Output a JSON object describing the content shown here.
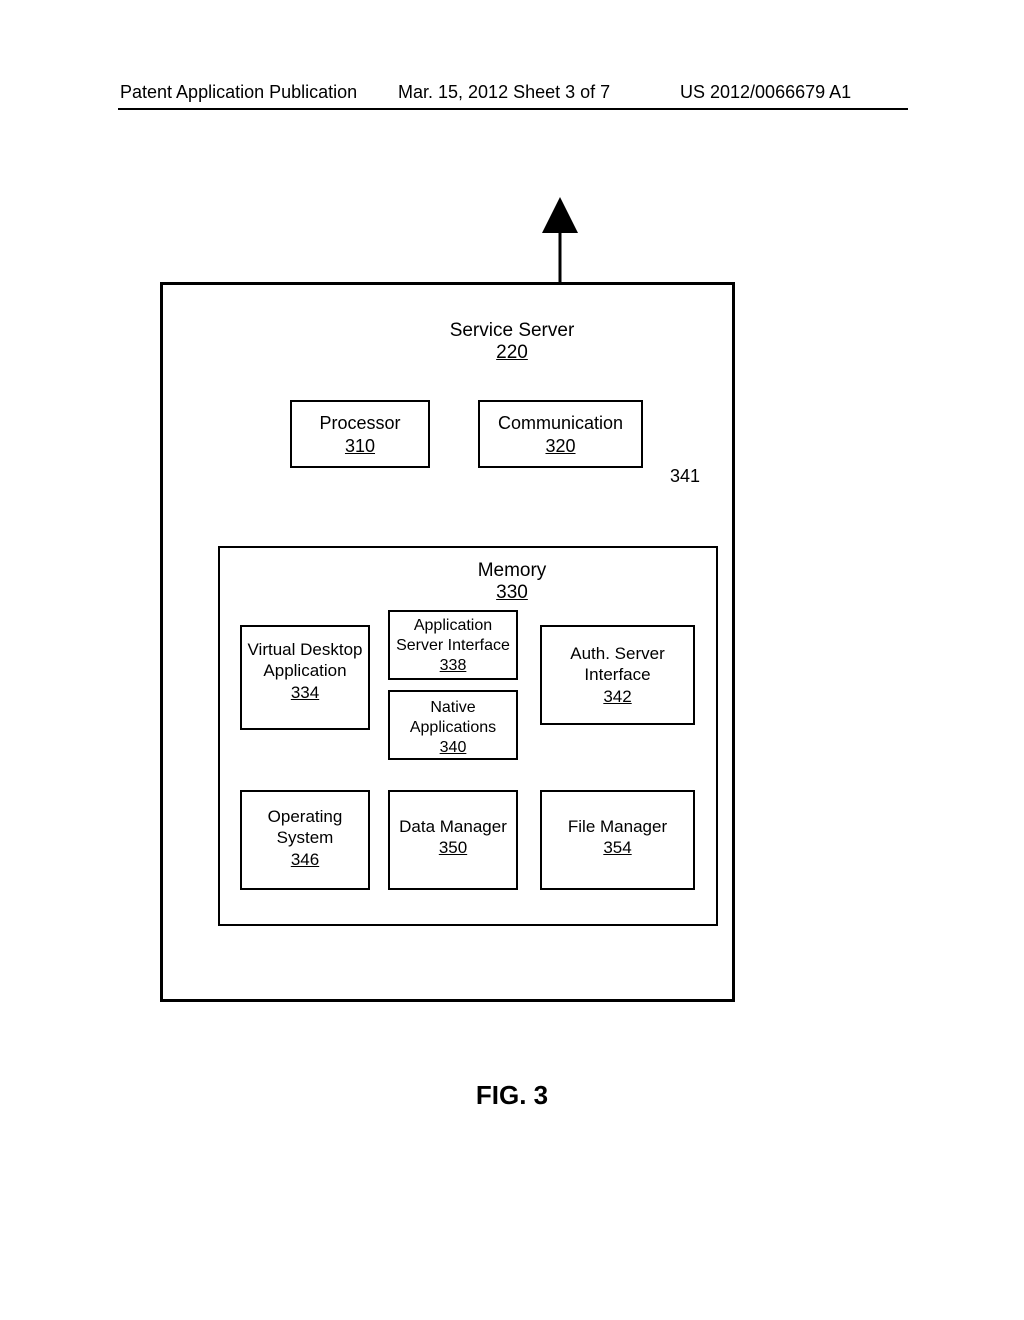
{
  "header": {
    "left": "Patent Application Publication",
    "mid": "Mar. 15, 2012  Sheet 3 of 7",
    "right": "US 2012/0066679 A1"
  },
  "outer": {
    "title": "Service Server",
    "ref": "220"
  },
  "proc": {
    "title": "Processor",
    "ref": "310"
  },
  "comm": {
    "title": "Communication",
    "ref": "320"
  },
  "busref": "341",
  "memory": {
    "title": "Memory",
    "ref": "330"
  },
  "vda": {
    "title": "Virtual Desktop Application",
    "ref": "334"
  },
  "asi": {
    "title": "Application Server Interface",
    "ref": "338"
  },
  "nat": {
    "title": "Native Applications",
    "ref": "340"
  },
  "auth": {
    "title": "Auth. Server Interface",
    "ref": "342"
  },
  "osb": {
    "title": "Operating System",
    "ref": "346"
  },
  "dmg": {
    "title": "Data Manager",
    "ref": "350"
  },
  "fmg": {
    "title": "File Manager",
    "ref": "354"
  },
  "figure": "FIG. 3",
  "chart_data": {
    "type": "block-diagram",
    "container": {
      "name": "Service Server",
      "ref": 220
    },
    "bus_ref": 341,
    "top_level_blocks": [
      {
        "name": "Processor",
        "ref": 310,
        "connects_to": "bus"
      },
      {
        "name": "Communication",
        "ref": 320,
        "connects_to": "bus",
        "external_arrow": "up"
      },
      {
        "name": "Memory",
        "ref": 330,
        "connects_to": "bus",
        "contains": [
          {
            "name": "Virtual Desktop Application",
            "ref": 334
          },
          {
            "name": "Application Server Interface",
            "ref": 338
          },
          {
            "name": "Native Applications",
            "ref": 340
          },
          {
            "name": "Auth. Server Interface",
            "ref": 342
          },
          {
            "name": "Operating System",
            "ref": 346
          },
          {
            "name": "Data Manager",
            "ref": 350
          },
          {
            "name": "File Manager",
            "ref": 354
          }
        ]
      }
    ]
  }
}
